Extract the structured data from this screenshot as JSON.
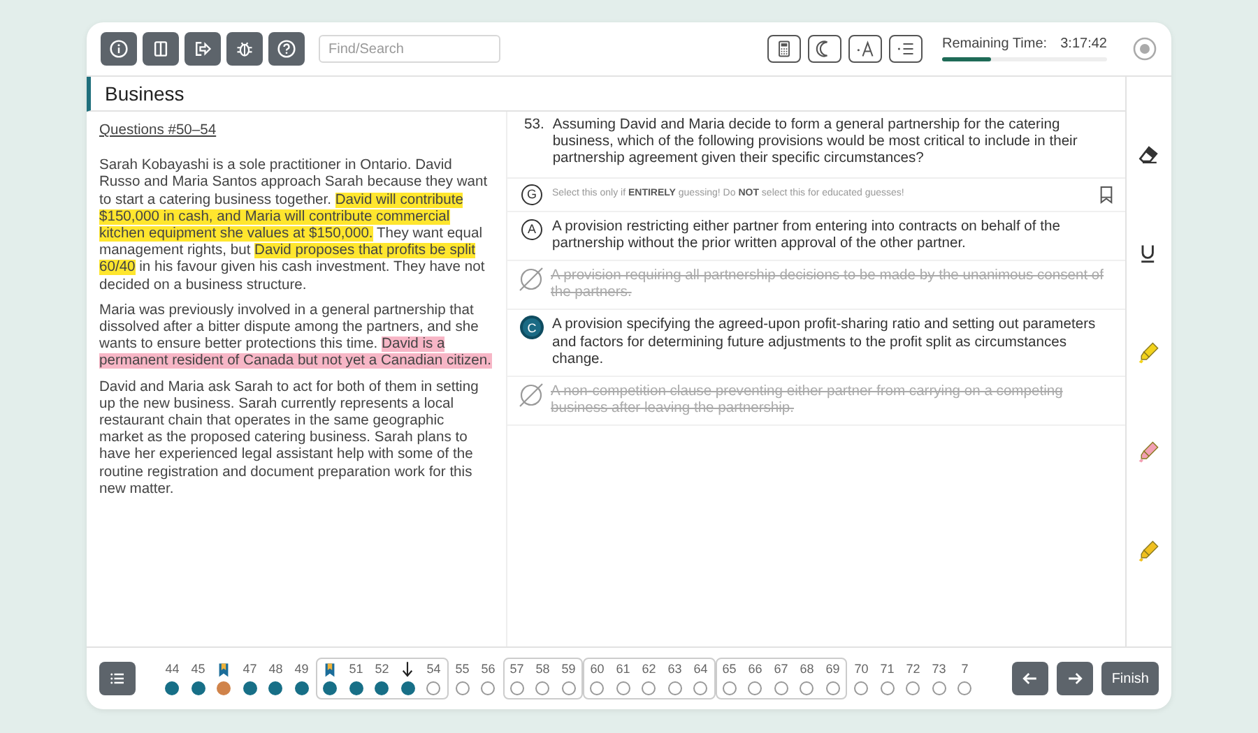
{
  "toolbar": {
    "left_buttons": [
      {
        "kind": "info"
      },
      {
        "kind": "pause"
      },
      {
        "kind": "exit"
      },
      {
        "kind": "bug"
      },
      {
        "kind": "help"
      }
    ],
    "search": {
      "placeholder": "Find/Search"
    },
    "right_buttons": [
      {
        "kind": "calculator"
      },
      {
        "kind": "moon"
      },
      {
        "kind": "font"
      },
      {
        "kind": "spacing"
      }
    ],
    "timer": {
      "label": "Remaining Time:",
      "value": "3:17:42",
      "level": 0.3
    }
  },
  "section_title": "Business",
  "passage": {
    "heading": "Questions #50–54",
    "paragraphs": [
      [
        {
          "text": "Sarah Kobayashi is a sole practitioner in Ontario. David Russo and Maria Santos approach Sarah because they want to start a catering business together. "
        },
        {
          "text": "David will contribute $150,000 in cash, and Maria will contribute commercial kitchen equipment she values at $150,000.",
          "color": "#ffe62e"
        },
        {
          "text": " They want equal management rights, but "
        },
        {
          "text": "David proposes that profits be split 60/40",
          "color": "#ffe62e"
        },
        {
          "text": " in his favour given his cash investment. They have not decided on a business structure."
        }
      ],
      [
        {
          "text": "Maria was previously involved in a general partnership that dissolved after a bitter dispute among the partners, and she wants to ensure better protections this time. "
        },
        {
          "text": "David is a permanent resident of Canada but not yet a Canadian citizen.",
          "color": "#f7b6c6"
        }
      ],
      [
        {
          "text": "David and Maria ask Sarah to act for both of them in setting up the new business. Sarah currently represents a local restaurant chain that operates in the same geographic market as the proposed catering business. Sarah plans to have her experienced legal assistant help with some of the routine registration and document preparation work for this new matter."
        }
      ]
    ]
  },
  "question": {
    "number": "53.",
    "text": "Assuming David and Maria decide to form a general partnership for the catering business, which of the following provisions would be most critical to include in their partnership agreement given their specific circumstances?",
    "guess": {
      "letter": "G",
      "text": "Select this only if **ENTIRELY** guessing! Do **NOT** select this for educated guesses!",
      "bookmarked": false
    },
    "options": [
      {
        "letter": "A",
        "text": "A provision restricting either partner from entering into contracts on behalf of the partnership without the prior written approval of the other partner.",
        "selected": false,
        "eliminated": false
      },
      {
        "text": "A provision requiring all partnership decisions to be made by the unanimous consent of the partners.",
        "selected": false,
        "eliminated": true
      },
      {
        "letter": "C",
        "text": "A provision specifying the agreed-upon profit-sharing ratio and setting out parameters and factors for determining future adjustments to the profit split as circumstances change.",
        "selected": true,
        "eliminated": false
      },
      {
        "text": "A non-competition clause preventing either partner from carrying on a competing business after leaving the partnership.",
        "selected": false,
        "eliminated": true
      }
    ]
  },
  "tools": [
    {
      "kind": "eraser"
    },
    {
      "kind": "underline"
    },
    {
      "kind": "highlighter",
      "color": "#f2d21c"
    },
    {
      "kind": "highlighter",
      "color": "#f2a0b4"
    },
    {
      "kind": "highlighter",
      "color": "#f0c020"
    }
  ],
  "nav": {
    "groups": [
      {
        "boxed": false,
        "items": [
          {
            "kind": "number",
            "label": "44",
            "answered": true,
            "flagged": false
          },
          {
            "kind": "number",
            "label": "45",
            "answered": true,
            "flagged": false
          },
          {
            "kind": "bookmark",
            "answered": true,
            "flagged": true
          },
          {
            "kind": "number",
            "label": "47",
            "answered": true,
            "flagged": false
          },
          {
            "kind": "number",
            "label": "48",
            "answered": true,
            "flagged": false
          },
          {
            "kind": "number",
            "label": "49",
            "answered": true,
            "flagged": false
          }
        ]
      },
      {
        "boxed": true,
        "items": [
          {
            "kind": "bookmark",
            "answered": true,
            "flagged": false
          },
          {
            "kind": "number",
            "label": "51",
            "answered": true,
            "flagged": false
          },
          {
            "kind": "number",
            "label": "52",
            "answered": true,
            "flagged": false
          },
          {
            "kind": "current",
            "answered": true,
            "flagged": false
          },
          {
            "kind": "number",
            "label": "54",
            "answered": false,
            "flagged": false
          }
        ]
      },
      {
        "boxed": false,
        "items": [
          {
            "kind": "number",
            "label": "55",
            "answered": false,
            "flagged": false
          },
          {
            "kind": "number",
            "label": "56",
            "answered": false,
            "flagged": false
          }
        ]
      },
      {
        "boxed": true,
        "items": [
          {
            "kind": "number",
            "label": "57",
            "answered": false,
            "flagged": false
          },
          {
            "kind": "number",
            "label": "58",
            "answered": false,
            "flagged": false
          },
          {
            "kind": "number",
            "label": "59",
            "answered": false,
            "flagged": false
          }
        ]
      },
      {
        "boxed": true,
        "items": [
          {
            "kind": "number",
            "label": "60",
            "answered": false,
            "flagged": false
          },
          {
            "kind": "number",
            "label": "61",
            "answered": false,
            "flagged": false
          },
          {
            "kind": "number",
            "label": "62",
            "answered": false,
            "flagged": false
          },
          {
            "kind": "number",
            "label": "63",
            "answered": false,
            "flagged": false
          },
          {
            "kind": "number",
            "label": "64",
            "answered": false,
            "flagged": false
          }
        ]
      },
      {
        "boxed": true,
        "items": [
          {
            "kind": "number",
            "label": "65",
            "answered": false,
            "flagged": false
          },
          {
            "kind": "number",
            "label": "66",
            "answered": false,
            "flagged": false
          },
          {
            "kind": "number",
            "label": "67",
            "answered": false,
            "flagged": false
          },
          {
            "kind": "number",
            "label": "68",
            "answered": false,
            "flagged": false
          },
          {
            "kind": "number",
            "label": "69",
            "answered": false,
            "flagged": false
          }
        ]
      },
      {
        "boxed": false,
        "items": [
          {
            "kind": "number",
            "label": "70",
            "answered": false,
            "flagged": false
          },
          {
            "kind": "number",
            "label": "71",
            "answered": false,
            "flagged": false
          },
          {
            "kind": "number",
            "label": "72",
            "answered": false,
            "flagged": false
          },
          {
            "kind": "number",
            "label": "73",
            "answered": false,
            "flagged": false
          },
          {
            "kind": "number",
            "label": "7",
            "answered": false,
            "flagged": false
          }
        ]
      }
    ],
    "finish_label": "Finish"
  }
}
